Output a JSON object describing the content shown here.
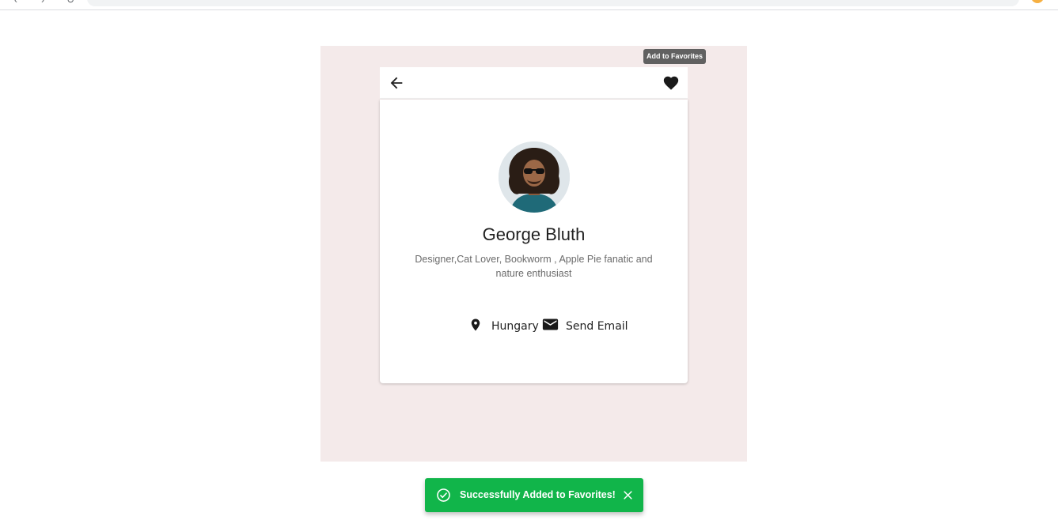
{
  "tooltip": {
    "text": "Add to Favorites"
  },
  "header": {
    "back_icon": "arrow-back-icon",
    "favorite_icon": "heart-icon"
  },
  "profile": {
    "name": "George Bluth",
    "bio": "Designer,Cat Lover, Bookworm , Apple Pie fanatic and nature enthusiast",
    "location": "Hungary",
    "email_label": "Send Email",
    "location_icon": "location-pin-icon",
    "email_icon": "mail-icon"
  },
  "snackbar": {
    "message": "Successfully Added to Favorites!",
    "icon": "check-circle-icon",
    "close_icon": "close-icon"
  },
  "colors": {
    "stage_background": "#f4eaea",
    "snackbar_background": "#11b54a",
    "tooltip_background": "#616161"
  }
}
